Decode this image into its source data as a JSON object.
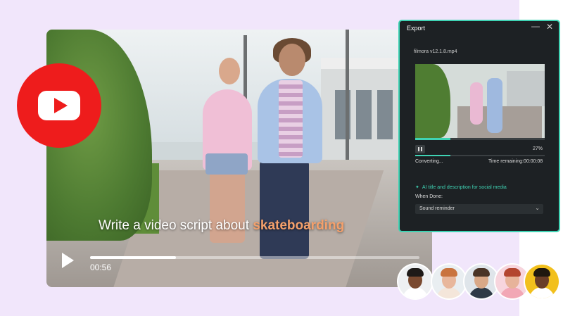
{
  "video": {
    "caption_prefix": "Write a video script about ",
    "caption_highlight": "skateboarding",
    "time": "00:56",
    "progress": 0.26
  },
  "export_dialog": {
    "title": "Export",
    "filename": "filmora v12.1.8.mp4",
    "percent": "27%",
    "progress": 0.27,
    "status": "Converting...",
    "time_remaining": "Time remaining:00:00:08",
    "ai_title": "AI title and description for social media",
    "when_done_label": "When Done:",
    "when_done_value": "Sound reminder"
  },
  "colors": {
    "accent": "#3fd3b4",
    "youtube_red": "#ee1c1c",
    "highlight": "#f4a06b"
  },
  "avatars": [
    {
      "name": "avatar-1",
      "bg": "#eef0f2",
      "skin": "#7a4a30",
      "shirt": "#ffffff",
      "hair": "#1e1a18"
    },
    {
      "name": "avatar-2",
      "bg": "#e9eef1",
      "skin": "#e8b79c",
      "shirt": "#f4e6da",
      "hair": "#c9743f"
    },
    {
      "name": "avatar-3",
      "bg": "#dfe5ea",
      "skin": "#d9a887",
      "shirt": "#2f3a46",
      "hair": "#4a3426"
    },
    {
      "name": "avatar-4",
      "bg": "#f7d5dd",
      "skin": "#e7b39a",
      "shirt": "#f2a7b5",
      "hair": "#b3452f"
    },
    {
      "name": "avatar-5",
      "bg": "#f2c01d",
      "skin": "#6b3e28",
      "shirt": "#ffffff",
      "hair": "#20180f"
    }
  ]
}
